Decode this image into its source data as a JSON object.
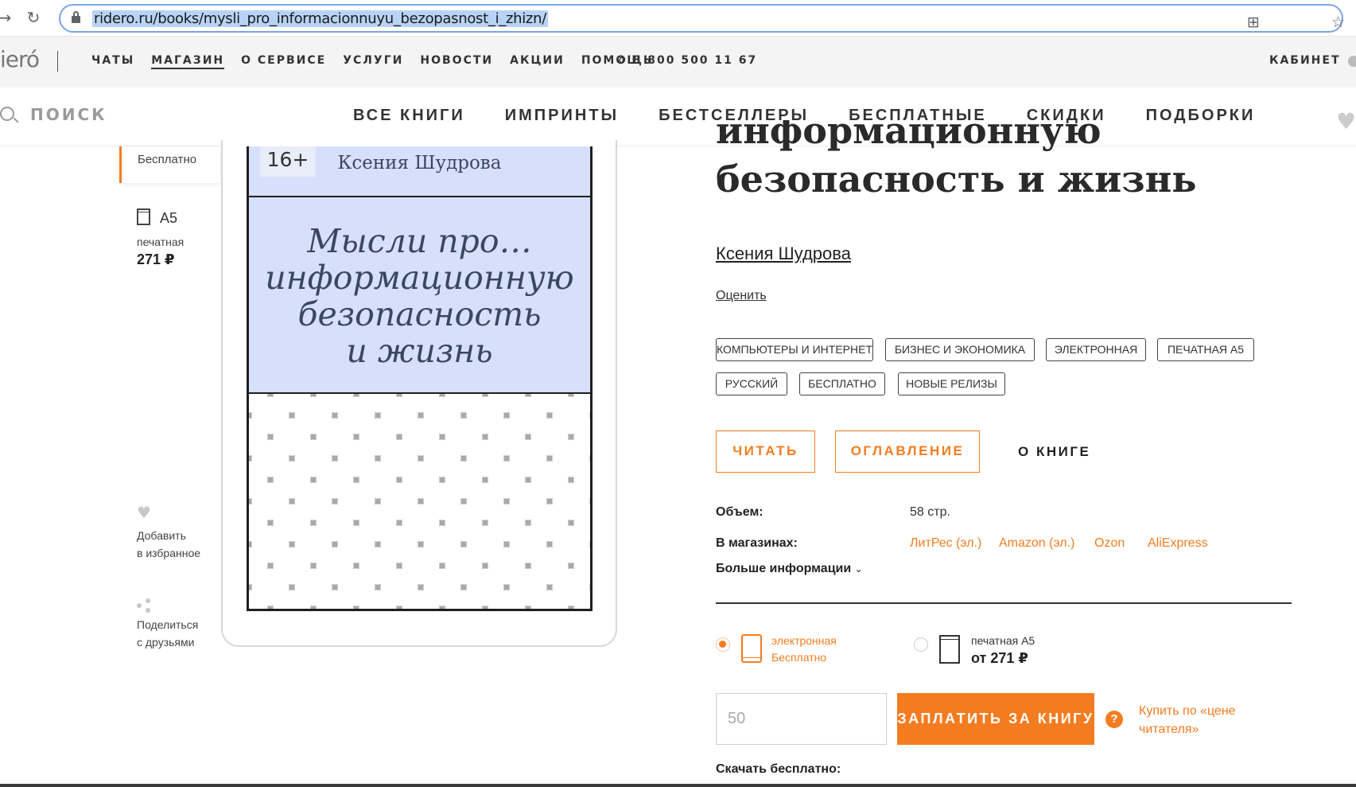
{
  "browser": {
    "url": "ridero.ru/books/mysli_pro_informacionnuyu_bezopasnost_i_zhizn/"
  },
  "site": {
    "logo": "ieró",
    "top_menu": [
      "ЧАТЫ",
      "МАГАЗИН",
      "О СЕРВИСЕ",
      "УСЛУГИ",
      "НОВОСТИ",
      "АКЦИИ",
      "ПОМОЩЬ"
    ],
    "active_menu": "МАГАЗИН",
    "phone": "8 800 500 11 67",
    "cabinet": "КАБИНЕТ",
    "search_placeholder": "ПОИСК",
    "catalog_menu": [
      "ВСЕ КНИГИ",
      "ИМПРИНТЫ",
      "БЕСТСЕЛЛЕРЫ",
      "БЕСПЛАТНЫЕ",
      "СКИДКИ",
      "ПОДБОРКИ"
    ]
  },
  "left_panel": {
    "ebook_price": "Бесплатно",
    "format": "A5",
    "print_label": "печатная",
    "print_price": "271 ₽",
    "favorite_line1": "Добавить",
    "favorite_line2": "в избранное",
    "share_line1": "Поделиться",
    "share_line2": "с друзьями"
  },
  "cover": {
    "age": "16+",
    "author": "Ксения Шудрова",
    "title_lines": [
      "Мысли про…",
      "информационную",
      "безопасность",
      "и жизнь"
    ]
  },
  "book": {
    "title_line1": "информационную",
    "title_line2": "безопасность и жизнь",
    "author": "Ксения Шудрова",
    "rate": "Оценить",
    "tags": [
      "КОМПЬЮТЕРЫ И ИНТЕРНЕТ",
      "БИЗНЕС И ЭКОНОМИКА",
      "ЭЛЕКТРОННАЯ",
      "ПЕЧАТНАЯ A5",
      "РУССКИЙ",
      "БЕСПЛАТНО",
      "НОВЫЕ РЕЛИЗЫ"
    ],
    "read_button": "ЧИТАТЬ",
    "toc_button": "ОГЛАВЛЕНИЕ",
    "about_button": "О КНИГЕ",
    "volume_label": "Объем:",
    "volume_value": "58 стр.",
    "stores_label": "В магазинах:",
    "stores": [
      "ЛитРес (эл.)",
      "Amazon (эл.)",
      "Ozon",
      "AliExpress"
    ],
    "more_info": "Больше информации"
  },
  "purchase": {
    "ebook_label": "электронная",
    "ebook_price": "Бесплатно",
    "print_label": "печатная A5",
    "print_price": "от 271 ₽",
    "amount_placeholder": "50",
    "pay_button": "ЗАПЛАТИТЬ ЗА КНИГУ",
    "reader_price_link": "Купить по «цене читателя»",
    "download_label": "Скачать бесплатно:"
  },
  "colors": {
    "accent": "#f47c20",
    "cover_bg": "#d7e0fb"
  }
}
